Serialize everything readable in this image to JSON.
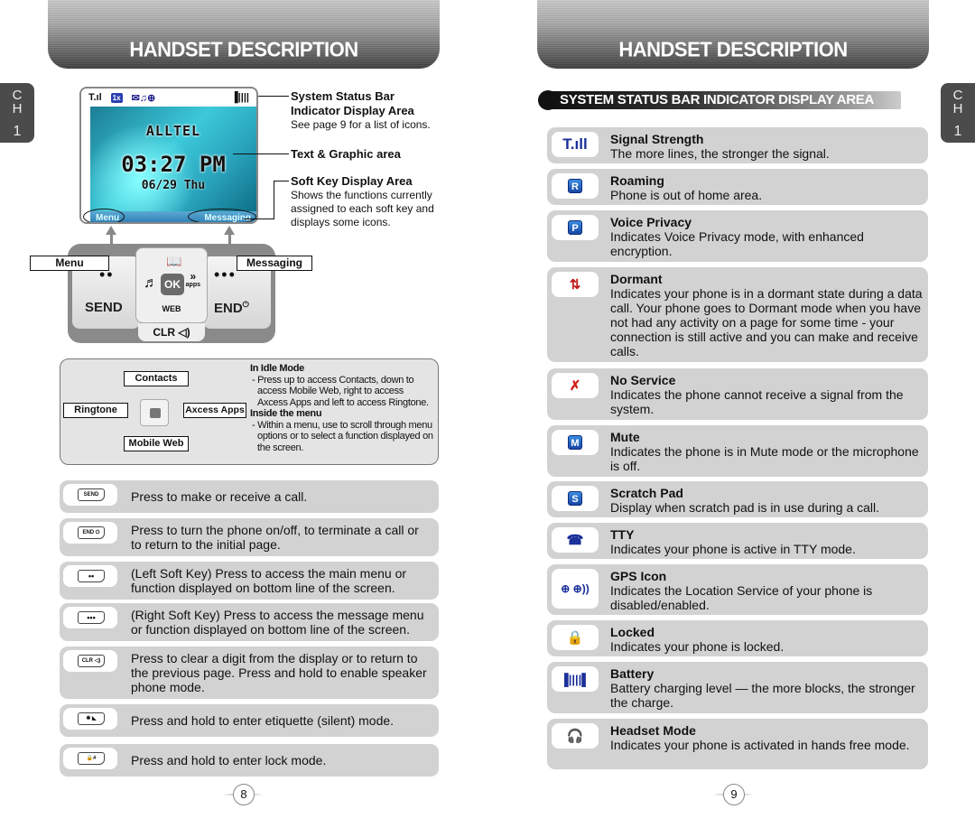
{
  "left_page": {
    "header_title": "HANDSET DESCRIPTION",
    "chapter_tab": {
      "letters": [
        "C",
        "H"
      ],
      "number": "1"
    },
    "phone_screen": {
      "status_icons": [
        "signal-icon",
        "1x-icon",
        "message-icon",
        "ringtone-icon",
        "gps-icon",
        "battery-icon"
      ],
      "status_glyphs": {
        "signal": "T.ıl",
        "onex": "1x",
        "msg": "✉♫⊕",
        "battery": "▐||||"
      },
      "carrier": "ALLTEL",
      "time": "03:27 PM",
      "date": "06/29 Thu",
      "left_softkey": "Menu",
      "right_softkey": "Messaging"
    },
    "callouts": [
      {
        "title": "System Status Bar",
        "title2": "Indicator Display Area",
        "text": "See page 9 for a list of icons."
      },
      {
        "title": "Text & Graphic area"
      },
      {
        "title": "Soft Key Display Area",
        "text": "Shows the functions currently assigned to each soft key and displays some icons."
      }
    ],
    "keypad": {
      "menu_label": "Menu",
      "messaging_label": "Messaging",
      "left_dots": "••",
      "right_dots": "•••",
      "send": "SEND",
      "end": "END",
      "end_symbol": "⏻",
      "ok": "OK",
      "up_symbol": "📖",
      "left_symbol": "♬",
      "right_symbol": "»",
      "right_sub": "apps",
      "web": "WEB",
      "clr": "CLR ◁)"
    },
    "nav_panel": {
      "up_label": "Contacts",
      "left_label": "Ringtone",
      "right_label": "Axcess Apps",
      "down_label": "Mobile Web",
      "heading1": "In Idle Mode",
      "text1": "- Press up to access Contacts, down to access Mobile Web, right to access Axcess Apps and left to access Ringtone.",
      "heading2": "Inside the menu",
      "text2": "- Within a menu, use to scroll through menu options or to select a function displayed on the screen."
    },
    "keys": [
      {
        "icon": "send-key-icon",
        "glyph": "SEND",
        "desc": "Press to make or receive a call."
      },
      {
        "icon": "end-key-icon",
        "glyph": "END ⏻",
        "desc": "Press to turn the phone on/off, to terminate a call or to return to the initial page."
      },
      {
        "icon": "left-soft-key-icon",
        "glyph": "••",
        "desc": "(Left Soft Key) Press to access the main menu or function displayed on bottom line of the screen."
      },
      {
        "icon": "right-soft-key-icon",
        "glyph": "•••",
        "desc": "(Right Soft Key) Press to access the message menu or function displayed on bottom line of the screen."
      },
      {
        "icon": "clr-key-icon",
        "glyph": "CLR ◁)",
        "desc": "Press to clear a digit from the display or to return to the previous page. Press and hold to enable speaker phone mode."
      },
      {
        "icon": "shift-star-key-icon",
        "glyph": "✱ ◣",
        "desc": "Press and hold to enter etiquette (silent) mode."
      },
      {
        "icon": "space-pound-key-icon",
        "glyph": "🔒#",
        "desc": "Press and hold to enter lock mode."
      }
    ],
    "page_number": "8"
  },
  "right_page": {
    "header_title": "HANDSET DESCRIPTION",
    "chapter_tab": {
      "letters": [
        "C",
        "H"
      ],
      "number": "1"
    },
    "section_title": "SYSTEM STATUS BAR INDICATOR DISPLAY AREA",
    "indicators": [
      {
        "icon": "signal-strength-icon",
        "glyph": "T.ıll",
        "title": "Signal Strength",
        "desc": "The more lines, the stronger the signal."
      },
      {
        "icon": "roaming-icon",
        "glyph": "R",
        "title": "Roaming",
        "desc": "Phone is out of home area."
      },
      {
        "icon": "voice-privacy-icon",
        "glyph": "P",
        "title": "Voice Privacy",
        "desc": "Indicates  Voice Privacy  mode, with enhanced encryption."
      },
      {
        "icon": "dormant-icon",
        "glyph": "⇅",
        "title": "Dormant",
        "desc": "Indicates your phone is in a dormant state during a data call. Your phone goes to Dormant mode when you have not had any activity on a page for some time - your connection is still active and you can make and receive calls."
      },
      {
        "icon": "no-service-icon",
        "glyph": "✗",
        "title": "No Service",
        "desc": "Indicates the phone cannot receive a signal from the system."
      },
      {
        "icon": "mute-icon",
        "glyph": "M",
        "title": "Mute",
        "desc": "Indicates the phone is in Mute mode or the microphone is off."
      },
      {
        "icon": "scratch-pad-icon",
        "glyph": "S",
        "title": "Scratch Pad",
        "desc": "Display when scratch pad is in use during a call."
      },
      {
        "icon": "tty-icon",
        "glyph": "☎",
        "title": "TTY",
        "desc": "Indicates your phone is active in TTY mode."
      },
      {
        "icon": "gps-icon",
        "glyph": "⊕ ⊕))",
        "title": "GPS Icon",
        "desc": "Indicates the Location Service of your phone is disabled/enabled."
      },
      {
        "icon": "locked-icon",
        "glyph": "🔒",
        "title": "Locked",
        "desc": "Indicates your phone is locked."
      },
      {
        "icon": "battery-icon",
        "glyph": "▐||||▌",
        "title": "Battery",
        "desc": "Battery charging level — the more blocks, the stronger the charge."
      },
      {
        "icon": "headset-mode-icon",
        "glyph": "🎧",
        "title": "Headset Mode",
        "desc": "Indicates your phone is activated in hands free mode."
      }
    ],
    "page_number": "9"
  }
}
